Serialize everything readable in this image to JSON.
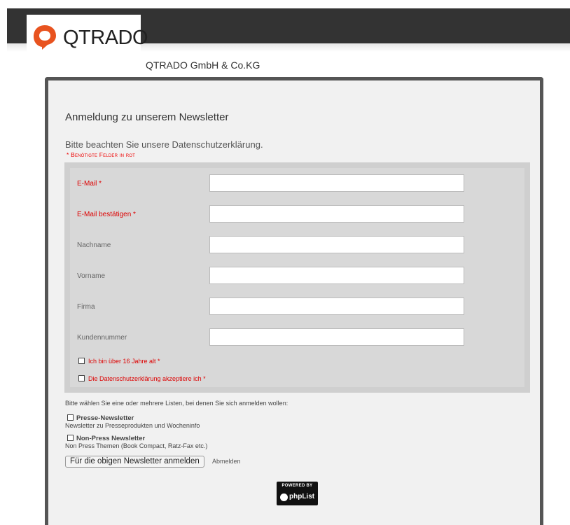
{
  "header": {
    "logo_text": "QTRADO",
    "company_name": "QTRADO GmbH & Co.KG"
  },
  "form": {
    "title": "Anmeldung zu unserem Newsletter",
    "privacy_text": "Bitte beachten Sie unsere Datenschutzerklärung.",
    "required_note": "* Benötigte Felder in rot",
    "fields": [
      {
        "label": "E-Mail *",
        "required": true,
        "value": ""
      },
      {
        "label": "E-Mail bestätigen *",
        "required": true,
        "value": ""
      },
      {
        "label": "Nachname",
        "required": false,
        "value": ""
      },
      {
        "label": "Vorname",
        "required": false,
        "value": ""
      },
      {
        "label": "Firma",
        "required": false,
        "value": ""
      },
      {
        "label": "Kundennummer",
        "required": false,
        "value": ""
      }
    ],
    "checkboxes": [
      {
        "label": "Ich bin über 16 Jahre alt *",
        "checked": false
      },
      {
        "label": "Die Datenschutzerklärung akzeptiere ich *",
        "checked": false
      }
    ]
  },
  "lists": {
    "intro": "Bitte wählen Sie eine oder mehrere Listen, bei denen Sie sich anmelden wollen:",
    "items": [
      {
        "name": "Presse-Newsletter",
        "description": "Newsletter zu Presseprodukten und Wocheninfo",
        "checked": false
      },
      {
        "name": "Non-Press Newsletter",
        "description": "Non Press Themen (Book Compact, Ratz-Fax etc.)",
        "checked": false
      }
    ]
  },
  "actions": {
    "submit_label": "Für die obigen Newsletter anmelden",
    "unsubscribe_label": "Abmelden"
  },
  "footer": {
    "powered_by": "POWERED BY",
    "phplist": "phpList"
  },
  "colors": {
    "header_bar": "#333333",
    "brand_orange": "#e8531f",
    "required_red": "#dd0000"
  }
}
